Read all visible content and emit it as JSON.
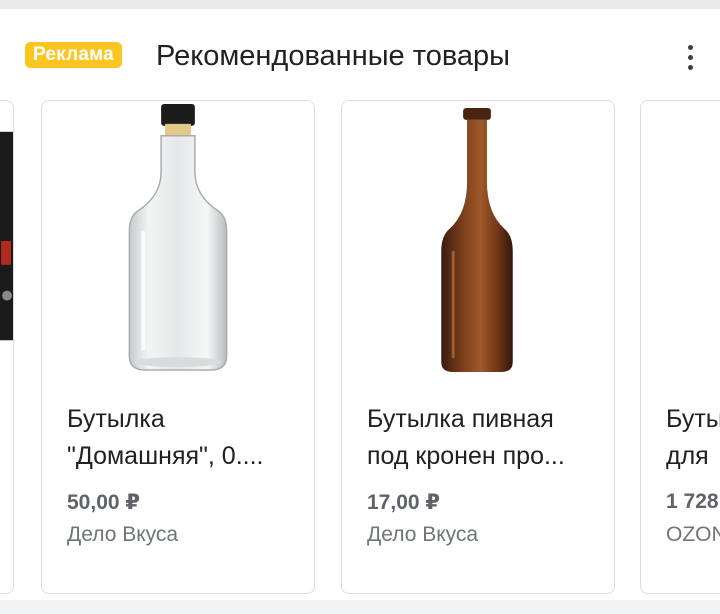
{
  "header": {
    "ad_label": "Реклама",
    "title": "Рекомендованные товары",
    "more_icon": "more-vert-icon"
  },
  "colors": {
    "ad_badge": "#fcc521",
    "title_text": "#202124",
    "price_text": "#5f6368",
    "seller_text": "#70757a",
    "card_border": "#dadce0"
  },
  "products": [
    {
      "name": "Бутылка\n\"Домашняя\", 0....",
      "price": "50,00 ₽",
      "seller": "Дело Вкуса",
      "image": "clear-glass-bottle-with-cork"
    },
    {
      "name": "Бутылка пивная\nпод кронен про...",
      "price": "17,00 ₽",
      "seller": "Дело Вкуса",
      "image": "brown-beer-bottle"
    },
    {
      "name": "Бутылка\nдля",
      "price": "1 728",
      "seller": "OZON",
      "image": "product-image"
    }
  ]
}
